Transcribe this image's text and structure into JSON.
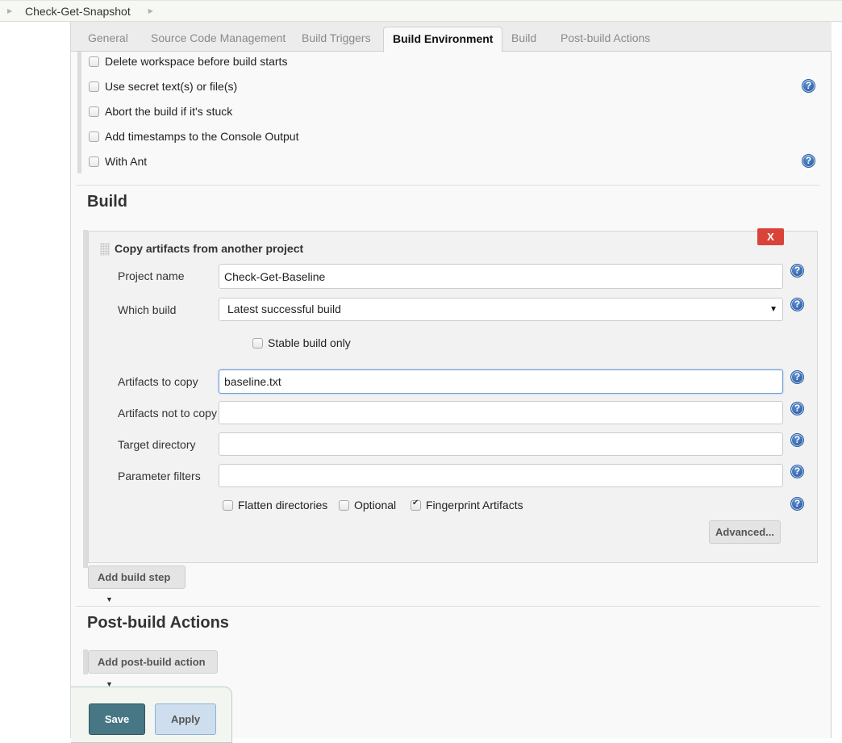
{
  "breadcrumb": {
    "items": [
      {
        "label": "Check-Get-Snapshot"
      }
    ]
  },
  "tabs": [
    {
      "label": "General",
      "active": false
    },
    {
      "label": "Source Code Management",
      "active": false
    },
    {
      "label": "Build Triggers",
      "active": false
    },
    {
      "label": "Build Environment",
      "active": true
    },
    {
      "label": "Build",
      "active": false
    },
    {
      "label": "Post-build Actions",
      "active": false
    }
  ],
  "build_environment": {
    "options": [
      {
        "label": "Delete workspace before build starts",
        "checked": false,
        "help": false
      },
      {
        "label": "Use secret text(s) or file(s)",
        "checked": false,
        "help": true
      },
      {
        "label": "Abort the build if it's stuck",
        "checked": false,
        "help": false
      },
      {
        "label": "Add timestamps to the Console Output",
        "checked": false,
        "help": false
      },
      {
        "label": "With Ant",
        "checked": false,
        "help": true
      }
    ]
  },
  "build": {
    "title": "Build",
    "step": {
      "title": "Copy artifacts from another project",
      "delete_label": "X",
      "project_name": {
        "label": "Project name",
        "value": "Check-Get-Baseline"
      },
      "which_build": {
        "label": "Which build",
        "selected": "Latest successful build"
      },
      "stable_only": {
        "label": "Stable build only",
        "checked": false
      },
      "artifacts_to_copy": {
        "label": "Artifacts to copy",
        "value": "baseline.txt"
      },
      "artifacts_not_to_copy": {
        "label": "Artifacts not to copy",
        "value": ""
      },
      "target_directory": {
        "label": "Target directory",
        "value": ""
      },
      "parameter_filters": {
        "label": "Parameter filters",
        "value": ""
      },
      "flatten": {
        "label": "Flatten directories",
        "checked": false
      },
      "optional": {
        "label": "Optional",
        "checked": false
      },
      "fingerprint": {
        "label": "Fingerprint Artifacts",
        "checked": true
      },
      "advanced_label": "Advanced..."
    },
    "add_step_label": "Add build step"
  },
  "post_build": {
    "title": "Post-build Actions",
    "add_action_label": "Add post-build action"
  },
  "footer": {
    "save_label": "Save",
    "apply_label": "Apply"
  },
  "icons": {
    "help": "?",
    "caret": "▼",
    "crumb_arrow": "▶"
  }
}
